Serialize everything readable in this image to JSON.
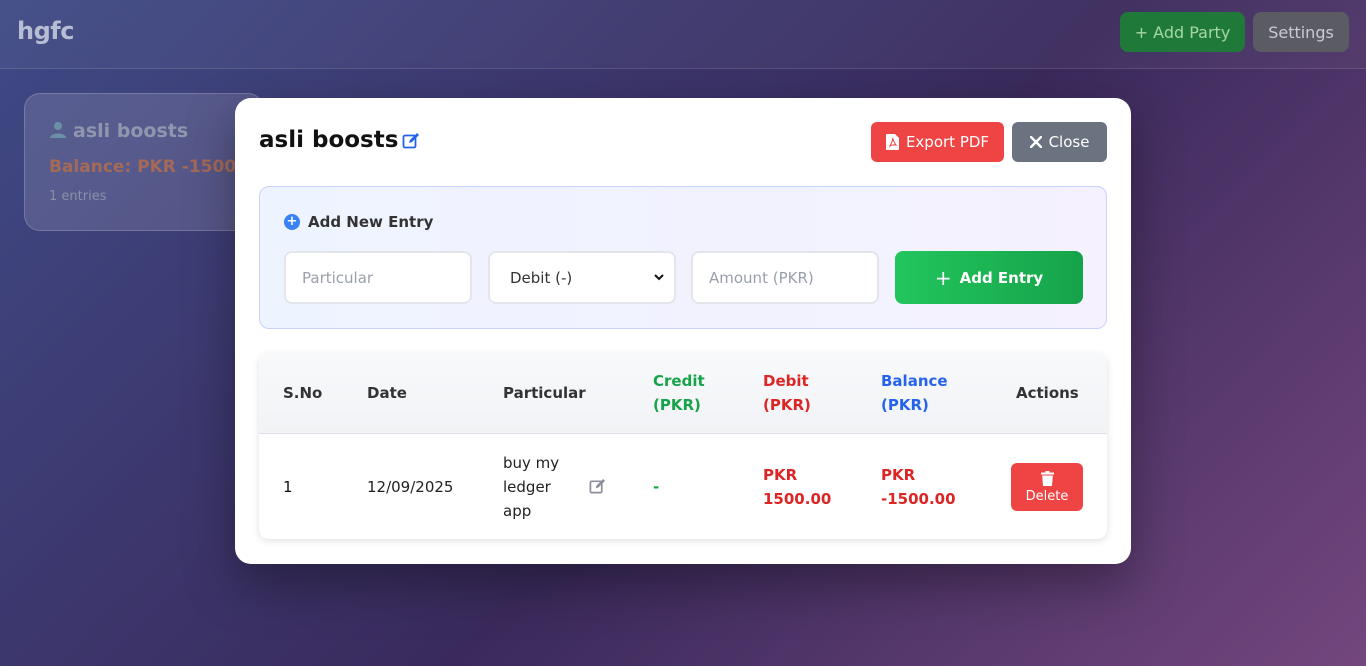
{
  "app": {
    "brand": "hgfc",
    "add_party_label": "+ Add Party",
    "settings_label": "Settings"
  },
  "party_card": {
    "name": "asli boosts",
    "balance": "Balance: PKR -1500.0",
    "entries": "1 entries"
  },
  "modal": {
    "title": "asli boosts",
    "export_label": "Export PDF",
    "close_label": "Close",
    "entry_form": {
      "heading": "Add New Entry",
      "particular_placeholder": "Particular",
      "type_value": "Debit (-)",
      "amount_placeholder": "Amount (PKR)",
      "add_label": "Add Entry"
    },
    "table": {
      "headers": {
        "sno": "S.No",
        "date": "Date",
        "particular": "Particular",
        "credit_1": "Credit",
        "credit_2": "(PKR)",
        "debit_1": "Debit",
        "debit_2": "(PKR)",
        "balance_1": "Balance",
        "balance_2": "(PKR)",
        "actions": "Actions"
      },
      "rows": [
        {
          "sno": "1",
          "date": "12/09/2025",
          "particular_1": "buy my",
          "particular_2": "ledger",
          "particular_3": "app",
          "credit": "-",
          "debit_1": "PKR",
          "debit_2": "1500.00",
          "balance_1": "PKR",
          "balance_2": "-1500.00",
          "delete_label": "Delete"
        }
      ]
    }
  },
  "colors": {
    "accent_green": "#22c55e",
    "danger_red": "#ef4444",
    "balance_blue": "#2563eb",
    "neutral_gray": "#6b7280"
  },
  "icons": [
    "user-icon",
    "edit-icon",
    "pdf-icon",
    "close-icon",
    "plus-circle-icon",
    "plus-icon",
    "trash-icon",
    "chevron-down-icon"
  ]
}
